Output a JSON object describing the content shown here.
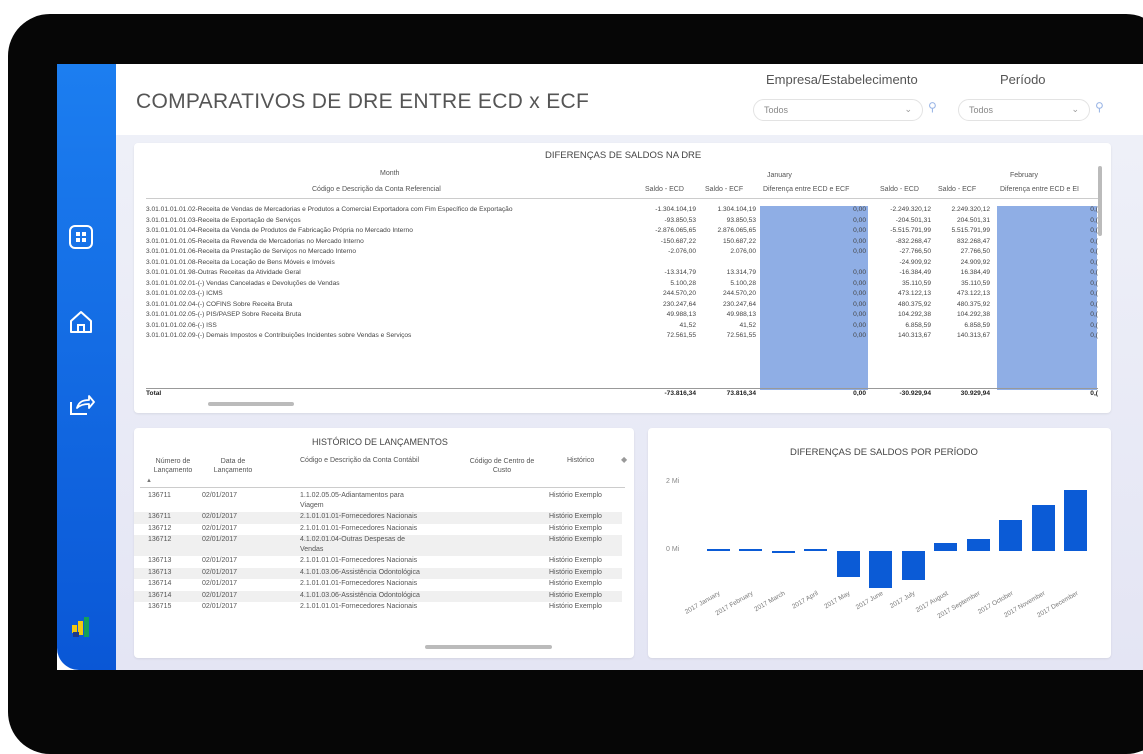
{
  "page_title": "COMPARATIVOS DE DRE ENTRE ECD x ECF",
  "filters": {
    "empresa_label": "Empresa/Estabelecimento",
    "empresa_value": "Todos",
    "periodo_label": "Período",
    "periodo_value": "Todos"
  },
  "dre": {
    "title": "DIFERENÇAS DE SALDOS NA DRE",
    "month_label": "Month",
    "account_label": "Código e Descrição da Conta Referencial",
    "months": [
      "January",
      "February"
    ],
    "col_headers": [
      "Saldo - ECD",
      "Saldo - ECF",
      "Diferença entre ECD e ECF",
      "Saldo - ECD",
      "Saldo - ECF",
      "Diferença entre ECD e EI"
    ],
    "rows": [
      {
        "account": "3.01.01.01.01.02-Receita de Vendas de Mercadorias e Produtos a Comercial Exportadora com Fim Específico de Exportação",
        "jan_ecd": "-1.304.104,19",
        "jan_ecf": "1.304.104,19",
        "jan_diff": "0,00",
        "feb_ecd": "-2.249.320,12",
        "feb_ecf": "2.249.320,12",
        "feb_diff": "0,("
      },
      {
        "account": "3.01.01.01.01.03-Receita de Exportação de Serviços",
        "jan_ecd": "-93.850,53",
        "jan_ecf": "93.850,53",
        "jan_diff": "0,00",
        "feb_ecd": "-204.501,31",
        "feb_ecf": "204.501,31",
        "feb_diff": "0,("
      },
      {
        "account": "3.01.01.01.01.04-Receita da Venda de Produtos de Fabricação Própria no Mercado Interno",
        "jan_ecd": "-2.876.065,65",
        "jan_ecf": "2.876.065,65",
        "jan_diff": "0,00",
        "feb_ecd": "-5.515.791,99",
        "feb_ecf": "5.515.791,99",
        "feb_diff": "0,("
      },
      {
        "account": "3.01.01.01.01.05-Receita da Revenda de Mercadorias no Mercado Interno",
        "jan_ecd": "-150.687,22",
        "jan_ecf": "150.687,22",
        "jan_diff": "0,00",
        "feb_ecd": "-832.268,47",
        "feb_ecf": "832.268,47",
        "feb_diff": "0,("
      },
      {
        "account": "3.01.01.01.01.06-Receita da Prestação de Serviços no Mercado Interno",
        "jan_ecd": "-2.076,00",
        "jan_ecf": "2.076,00",
        "jan_diff": "0,00",
        "feb_ecd": "-27.766,50",
        "feb_ecf": "27.766,50",
        "feb_diff": "0,("
      },
      {
        "account": "3.01.01.01.01.08-Receita da Locação de Bens Móveis e Imóveis",
        "jan_ecd": "",
        "jan_ecf": "",
        "jan_diff": "",
        "feb_ecd": "-24.909,92",
        "feb_ecf": "24.909,92",
        "feb_diff": "0,("
      },
      {
        "account": "3.01.01.01.01.98-Outras Receitas da Atividade Geral",
        "jan_ecd": "-13.314,79",
        "jan_ecf": "13.314,79",
        "jan_diff": "0,00",
        "feb_ecd": "-16.384,49",
        "feb_ecf": "16.384,49",
        "feb_diff": "0,("
      },
      {
        "account": "3.01.01.01.02.01-(-) Vendas Canceladas e Devoluções de Vendas",
        "jan_ecd": "5.100,28",
        "jan_ecf": "5.100,28",
        "jan_diff": "0,00",
        "feb_ecd": "35.110,59",
        "feb_ecf": "35.110,59",
        "feb_diff": "0,("
      },
      {
        "account": "3.01.01.01.02.03-(-) ICMS",
        "jan_ecd": "244.570,20",
        "jan_ecf": "244.570,20",
        "jan_diff": "0,00",
        "feb_ecd": "473.122,13",
        "feb_ecf": "473.122,13",
        "feb_diff": "0,("
      },
      {
        "account": "3.01.01.01.02.04-(-) COFINS Sobre Receita Bruta",
        "jan_ecd": "230.247,64",
        "jan_ecf": "230.247,64",
        "jan_diff": "0,00",
        "feb_ecd": "480.375,92",
        "feb_ecf": "480.375,92",
        "feb_diff": "0,("
      },
      {
        "account": "3.01.01.01.02.05-(-) PIS/PASEP Sobre Receita Bruta",
        "jan_ecd": "49.988,13",
        "jan_ecf": "49.988,13",
        "jan_diff": "0,00",
        "feb_ecd": "104.292,38",
        "feb_ecf": "104.292,38",
        "feb_diff": "0,("
      },
      {
        "account": "3.01.01.01.02.06-(-) ISS",
        "jan_ecd": "41,52",
        "jan_ecf": "41,52",
        "jan_diff": "0,00",
        "feb_ecd": "6.858,59",
        "feb_ecf": "6.858,59",
        "feb_diff": "0,("
      },
      {
        "account": "3.01.01.01.02.09-(-) Demais Impostos e Contribuições Incidentes sobre Vendas e Serviços",
        "jan_ecd": "72.561,55",
        "jan_ecf": "72.561,55",
        "jan_diff": "0,00",
        "feb_ecd": "140.313,67",
        "feb_ecf": "140.313,67",
        "feb_diff": "0,("
      }
    ],
    "total": {
      "label": "Total",
      "jan_ecd": "-73.816,34",
      "jan_ecf": "73.816,34",
      "jan_diff": "0,00",
      "feb_ecd": "-30.929,94",
      "feb_ecf": "30.929,94",
      "feb_diff": "0,("
    }
  },
  "historico": {
    "title": "HISTÓRICO DE LANÇAMENTOS",
    "headers": [
      "Número de Lançamento",
      "Data de Lançamento",
      "Código e Descrição da Conta Contábil",
      "Código de Centro de Custo",
      "Histórico"
    ],
    "rows": [
      {
        "num": "136711",
        "data": "02/01/2017",
        "conta": "1.1.02.05.05-Adiantamentos para",
        "conta2": "Viagem",
        "hist": "Histório Exemplo"
      },
      {
        "num": "136711",
        "data": "02/01/2017",
        "conta": "2.1.01.01.01-Fornecedores Nacionais",
        "conta2": "",
        "hist": "Histório Exemplo"
      },
      {
        "num": "136712",
        "data": "02/01/2017",
        "conta": "2.1.01.01.01-Fornecedores Nacionais",
        "conta2": "",
        "hist": "Histório Exemplo"
      },
      {
        "num": "136712",
        "data": "02/01/2017",
        "conta": "4.1.02.01.04-Outras Despesas de",
        "conta2": "Vendas",
        "hist": "Histório Exemplo"
      },
      {
        "num": "136713",
        "data": "02/01/2017",
        "conta": "2.1.01.01.01-Fornecedores Nacionais",
        "conta2": "",
        "hist": "Histório Exemplo"
      },
      {
        "num": "136713",
        "data": "02/01/2017",
        "conta": "4.1.01.03.06-Assistência Odontológica",
        "conta2": "",
        "hist": "Histório Exemplo"
      },
      {
        "num": "136714",
        "data": "02/01/2017",
        "conta": "2.1.01.01.01-Fornecedores Nacionais",
        "conta2": "",
        "hist": "Histório Exemplo"
      },
      {
        "num": "136714",
        "data": "02/01/2017",
        "conta": "4.1.01.03.06-Assistência Odontológica",
        "conta2": "",
        "hist": "Histório Exemplo"
      },
      {
        "num": "136715",
        "data": "02/01/2017",
        "conta": "2.1.01.01.01-Fornecedores Nacionais",
        "conta2": "",
        "hist": "Histório Exemplo"
      }
    ]
  },
  "chart_data": {
    "type": "bar",
    "title": "DIFERENÇAS DE SALDOS POR PERÍODO",
    "ytick_labels": [
      "2 Mi",
      "0 Mi"
    ],
    "categories": [
      "2017 January",
      "2017 February",
      "2017 March",
      "2017 April",
      "2017 May",
      "2017 June",
      "2017 July",
      "2017 August",
      "2017 September",
      "2017 October",
      "2017 November",
      "2017 December"
    ],
    "values": [
      0.07,
      0.03,
      -0.07,
      0.02,
      -0.75,
      -1.1,
      -0.85,
      0.25,
      0.35,
      0.92,
      1.35,
      1.78
    ],
    "ylim": [
      -1.5,
      2.3
    ],
    "color": "#0b5bd6"
  },
  "colors": {
    "sidebar": "#0a57d6",
    "accent_blue": "#8faee5",
    "bar": "#0b5bd6"
  }
}
